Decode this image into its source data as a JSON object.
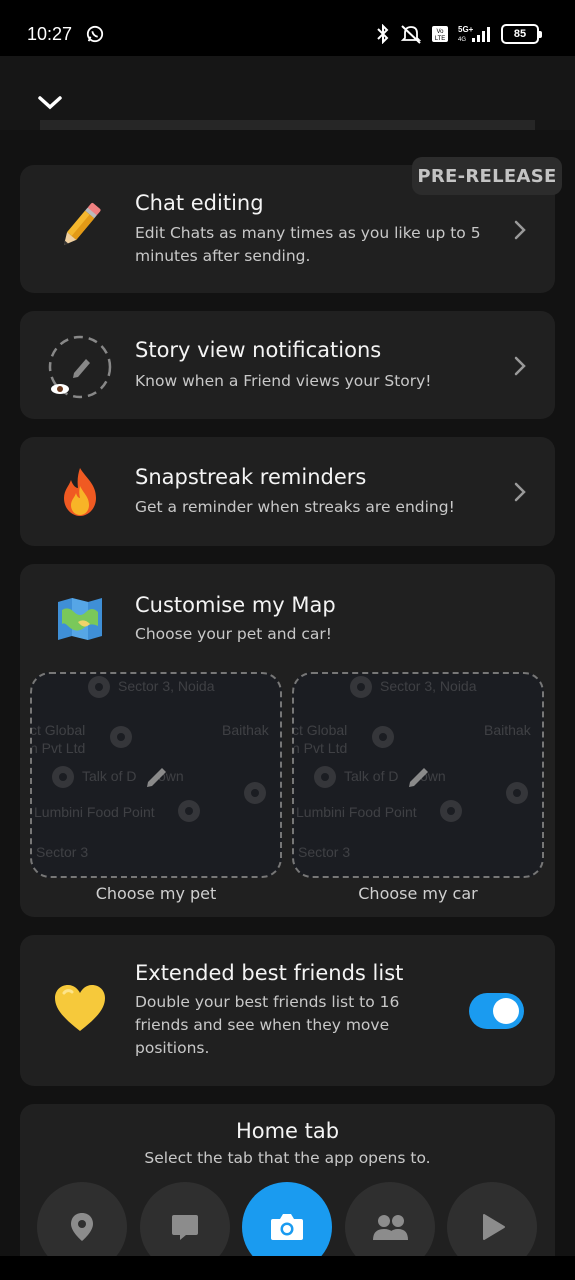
{
  "status": {
    "time": "10:27",
    "battery": "85",
    "icons": [
      "whatsapp-icon",
      "bluetooth-icon",
      "mute-icon",
      "volte-icon",
      "signal-5g-icon",
      "battery-icon"
    ]
  },
  "topbar": {
    "back_icon": "chevron-down-icon"
  },
  "badge": {
    "label": "PRE-RELEASE"
  },
  "features": [
    {
      "title": "Chat editing",
      "desc": "Edit Chats as many times as you like up to 5 minutes after sending.",
      "icon": "pencil-icon"
    },
    {
      "title": "Story view notifications",
      "desc": "Know when a Friend views your Story!",
      "icon": "story-eye-icon"
    },
    {
      "title": "Snapstreak reminders",
      "desc": "Get a reminder when streaks are ending!",
      "icon": "fire-icon"
    }
  ],
  "map": {
    "title": "Customise my Map",
    "desc": "Choose your pet and car!",
    "icon": "map-icon",
    "tiles": [
      {
        "label": "Choose my pet"
      },
      {
        "label": "Choose my car"
      }
    ],
    "map_labels": [
      "Sector 3, Noida",
      "ct Global",
      "n Pvt Ltd",
      "Baithak",
      "Talk of D",
      "own",
      "Lumbini Food Point",
      "Sector 3"
    ]
  },
  "bff": {
    "title": "Extended best friends list",
    "desc": "Double your best friends list to 16 friends and see when they move positions.",
    "icon": "yellow-heart-icon",
    "enabled": true
  },
  "home_tab": {
    "title": "Home tab",
    "desc": "Select the tab that the app opens to.",
    "tabs": [
      {
        "icon": "map-pin-icon",
        "active": false
      },
      {
        "icon": "chat-icon",
        "active": false
      },
      {
        "icon": "camera-icon",
        "active": true
      },
      {
        "icon": "friends-icon",
        "active": false
      },
      {
        "icon": "play-icon",
        "active": false
      }
    ]
  },
  "colors": {
    "accent": "#1a9bf0",
    "card": "#202020",
    "background": "#121212"
  }
}
